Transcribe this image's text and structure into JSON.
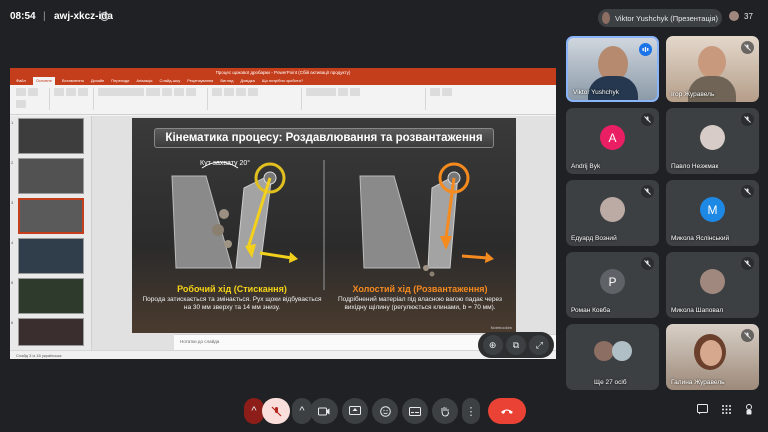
{
  "top": {
    "time": "08:54",
    "separator": "|",
    "meeting_code": "awj-xkcz-ida",
    "presenter_chip": "Viktor Yushchyk (Презентація)",
    "people_count": "37"
  },
  "powerpoint": {
    "window_title": "Процес щокової дробарки - PowerPoint (Сбій активації продукту)",
    "tabs": [
      "Файл",
      "Основне",
      "Вставлення",
      "Дизайн",
      "Переходи",
      "Анімація",
      "Слайд-шоу",
      "Рецензування",
      "Вигляд",
      "Довідка",
      "Що потрібно зробити?"
    ],
    "active_tab": "Основне",
    "notes_placeholder": "Нотатки до слайда",
    "status_text": "Слайд 3 із 18   українська",
    "thumb_numbers": [
      "1",
      "2",
      "3",
      "4",
      "5",
      "6"
    ]
  },
  "slide": {
    "title": "Кінематика процесу: Роздавлювання та розвантаження",
    "angle_label": "Кут захвату 20°",
    "left_title": "Робочий хід (Стискання)",
    "left_body": "Порода затискається та змінається. Рух щоки відбувається на 30 мм зверху та 14 мм знизу.",
    "right_title": "Холостий хід (Розвантаження)",
    "right_body": "Подрібнений матеріал під власною вагою падає через вихідну щілину (регулюється клинами, b = 70 мм).",
    "brand": "Notebooklm",
    "left_color": "#f7d417",
    "right_color": "#f58a1f"
  },
  "zoom_controls": {
    "zoom_icon": "zoom-in-icon",
    "open_icon": "open-in-new-icon",
    "fullscreen_icon": "fullscreen-icon"
  },
  "participants": [
    {
      "name": "Viktor Yushchyk",
      "kind": "video",
      "muted": false
    },
    {
      "name": "Ігор Журавель",
      "kind": "video",
      "muted": true
    },
    {
      "name": "Andrij Byk",
      "kind": "avatar",
      "initial": "A",
      "color": "#e91e63",
      "muted": true
    },
    {
      "name": "Павло Незжмак",
      "kind": "photo",
      "muted": true
    },
    {
      "name": "Едуард Возний",
      "kind": "photo",
      "muted": true
    },
    {
      "name": "Микола Яслінський",
      "kind": "avatar",
      "initial": "M",
      "color": "#1e88e5",
      "muted": true
    },
    {
      "name": "Роман Ковба",
      "kind": "avatar",
      "initial": "P",
      "color": "#5f6368",
      "muted": true
    },
    {
      "name": "Микола Шаповал",
      "kind": "photo",
      "muted": true
    },
    {
      "name": "Ще 27 осіб",
      "kind": "more",
      "muted": false
    },
    {
      "name": "Галина Журавель",
      "kind": "video",
      "muted": true
    }
  ],
  "accent": {
    "mic_off_bg": "#f9dedc",
    "hangup": "#ea4335"
  }
}
